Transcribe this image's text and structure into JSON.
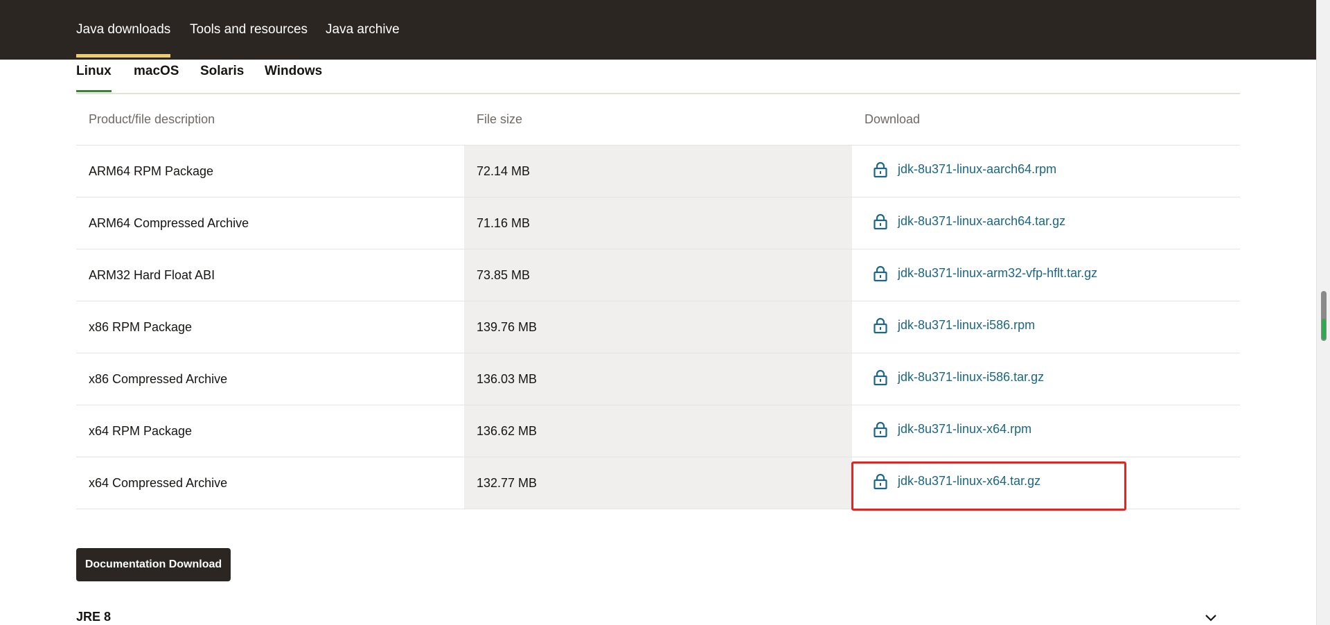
{
  "topnav": {
    "items": [
      {
        "label": "Java downloads",
        "active": true
      },
      {
        "label": "Tools and resources",
        "active": false
      },
      {
        "label": "Java archive",
        "active": false
      }
    ],
    "accent_color": "#f0cc71"
  },
  "os_tabs": [
    {
      "label": "Linux",
      "active": true
    },
    {
      "label": "macOS",
      "active": false
    },
    {
      "label": "Solaris",
      "active": false
    },
    {
      "label": "Windows",
      "active": false
    }
  ],
  "table": {
    "headers": [
      "Product/file description",
      "File size",
      "Download"
    ],
    "rows": [
      {
        "description": "ARM64 RPM Package",
        "size": "72.14 MB",
        "file": "jdk-8u371-linux-aarch64.rpm"
      },
      {
        "description": "ARM64 Compressed Archive",
        "size": "71.16 MB",
        "file": "jdk-8u371-linux-aarch64.tar.gz"
      },
      {
        "description": "ARM32 Hard Float ABI",
        "size": "73.85 MB",
        "file": "jdk-8u371-linux-arm32-vfp-hflt.tar.gz"
      },
      {
        "description": "x86 RPM Package",
        "size": "139.76 MB",
        "file": "jdk-8u371-linux-i586.rpm"
      },
      {
        "description": "x86 Compressed Archive",
        "size": "136.03 MB",
        "file": "jdk-8u371-linux-i586.tar.gz"
      },
      {
        "description": "x64 RPM Package",
        "size": "136.62 MB",
        "file": "jdk-8u371-linux-x64.rpm"
      },
      {
        "description": "x64 Compressed Archive",
        "size": "132.77 MB",
        "file": "jdk-8u371-linux-x64.tar.gz"
      }
    ],
    "link_color": "#1b6685",
    "highlight_color": "#e8221e"
  },
  "doc_button": {
    "label": "Documentation Download"
  },
  "next_section": {
    "title": "JRE 8",
    "icon": "chevron-down-icon"
  }
}
